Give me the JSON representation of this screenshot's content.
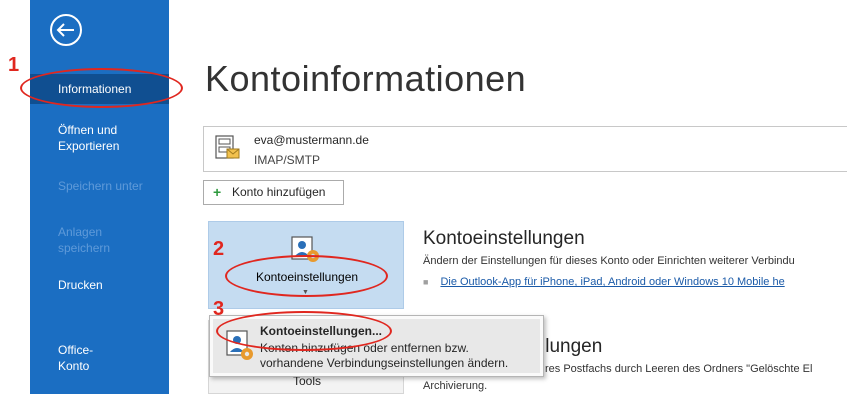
{
  "sidebar": {
    "items": [
      {
        "label": "Informationen"
      },
      {
        "label": "Öffnen und Exportieren"
      },
      {
        "label": "Speichern unter"
      },
      {
        "label": "Anlagen speichern"
      },
      {
        "label": "Drucken"
      },
      {
        "label": "Office-Konto"
      }
    ]
  },
  "main": {
    "title": "Kontoinformationen",
    "account": {
      "email": "eva@mustermann.de",
      "type": "IMAP/SMTP"
    },
    "add_account_label": "Konto hinzufügen",
    "account_settings_tile": {
      "label": "Kontoeinstellungen"
    },
    "account_settings_section": {
      "title": "Kontoeinstellungen",
      "description": "Ändern der Einstellungen für dieses Konto oder Einrichten weiterer Verbindu",
      "link": "Die Outlook-App für iPhone, iPad, Android oder Windows 10 Mobile he"
    },
    "tools_tile": {
      "label": "Tools"
    },
    "cleanup_section": {
      "title_fragment": "llungen",
      "desc_fragment": "res Postfachs durch Leeren des Ordners \"Gelöschte El",
      "desc_line2": "Archivierung."
    }
  },
  "dropdown": {
    "title": "Kontoeinstellungen...",
    "desc_line1": "Konten hinzufügen oder entfernen bzw.",
    "desc_line2": "vorhandene Verbindungseinstellungen ändern."
  },
  "annotations": {
    "marker1": "1",
    "marker2": "2",
    "marker3": "3",
    "color": "#e0271f"
  },
  "colors": {
    "sidebar": "#1b6ec2",
    "sidebar_selected": "#104f91",
    "tile_selected": "#c5dcf1"
  }
}
